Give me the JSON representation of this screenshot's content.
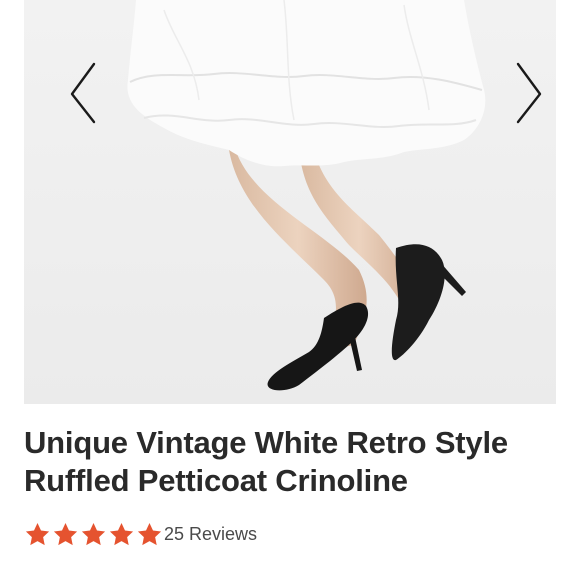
{
  "product": {
    "title_line1": "Unique Vintage White Retro Style",
    "title_line2": "Ruffled Petticoat Crinoline",
    "rating": 5,
    "rating_max": 5,
    "reviews_label": "25 Reviews"
  },
  "gallery": {
    "prev_icon": "chevron-left-icon",
    "next_icon": "chevron-right-icon",
    "image_subject": "white ruffled petticoat with black high-heel pumps"
  },
  "colors": {
    "star": "#e5532f",
    "title": "#2a2a2a",
    "reviews": "#4a4a4a",
    "gallery_bg": "#efefef",
    "arrow": "#1a1a1a"
  }
}
